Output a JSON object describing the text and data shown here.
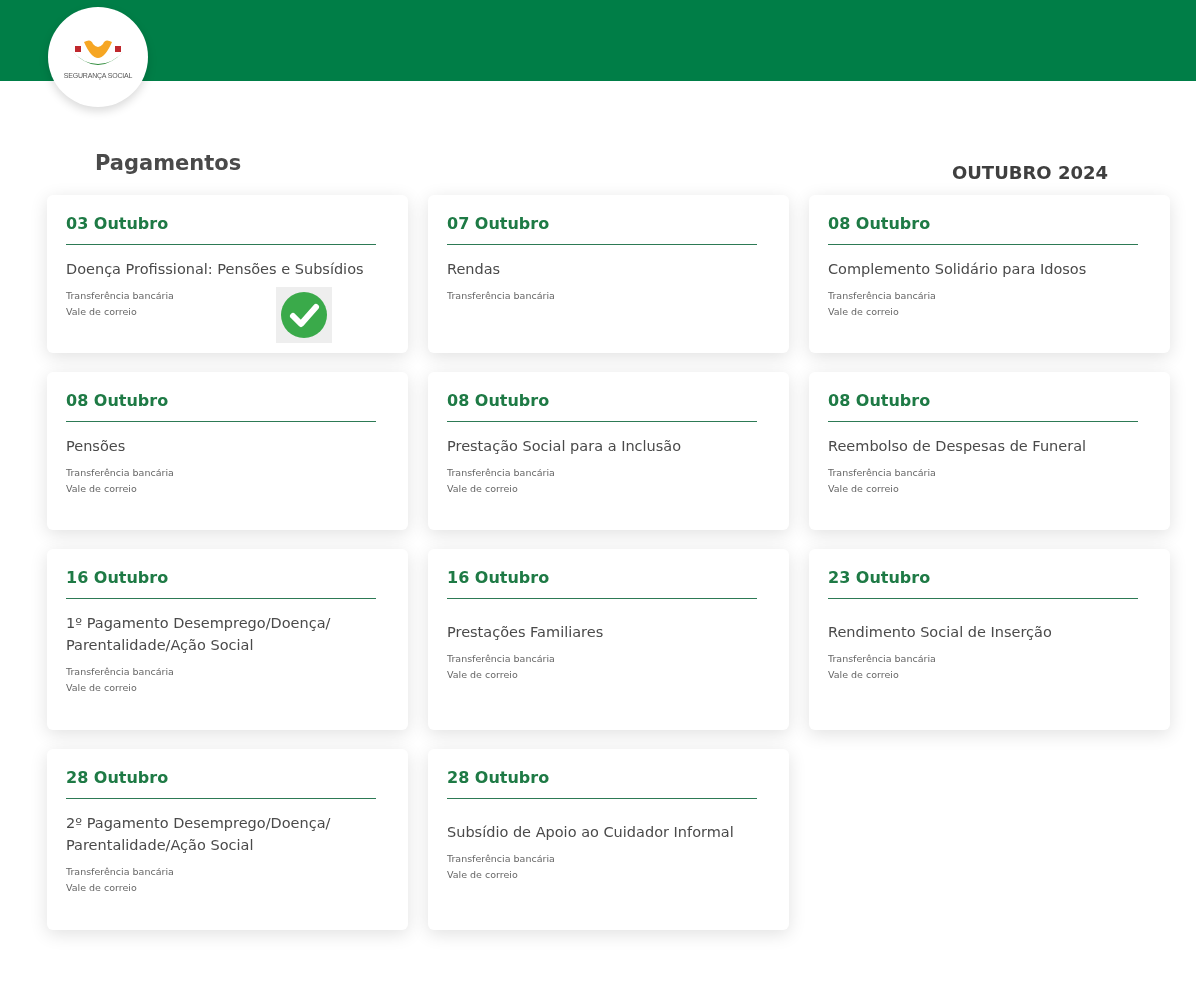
{
  "logo": {
    "text": "SEGURANÇA SOCIAL"
  },
  "heading": "Pagamentos",
  "month": "OUTUBRO 2024",
  "payments": [
    {
      "date": "03 Outubro",
      "title": "Doença Profissional: Pensões e Subsídios",
      "methods": [
        "Transferência bancária",
        "Vale de correio"
      ],
      "paid": true
    },
    {
      "date": "07 Outubro",
      "title": "Rendas",
      "methods": [
        "Transferência bancária"
      ],
      "paid": false
    },
    {
      "date": "08 Outubro",
      "title": "Complemento Solidário para Idosos",
      "methods": [
        "Transferência bancária",
        "Vale de correio"
      ],
      "paid": false
    },
    {
      "date": "08 Outubro",
      "title": "Pensões",
      "methods": [
        "Transferência bancária",
        "Vale de correio"
      ],
      "paid": false
    },
    {
      "date": "08 Outubro",
      "title": "Prestação Social para a Inclusão",
      "methods": [
        "Transferência bancária",
        "Vale de correio"
      ],
      "paid": false
    },
    {
      "date": "08 Outubro",
      "title": "Reembolso de Despesas de Funeral",
      "methods": [
        "Transferência bancária",
        "Vale de correio"
      ],
      "paid": false
    },
    {
      "date": "16 Outubro",
      "title": "1º Pagamento Desemprego/Doença/ Parentalidade/Ação Social",
      "methods": [
        "Transferência bancária",
        "Vale de correio"
      ],
      "paid": false
    },
    {
      "date": "16 Outubro",
      "title": "Prestações Familiares",
      "methods": [
        "Transferência bancária",
        "Vale de correio"
      ],
      "paid": false
    },
    {
      "date": "23 Outubro",
      "title": "Rendimento Social de Inserção",
      "methods": [
        "Transferência bancária",
        "Vale de correio"
      ],
      "paid": false
    },
    {
      "date": "28 Outubro",
      "title": "2º Pagamento Desemprego/Doença/ Parentalidade/Ação Social",
      "methods": [
        "Transferência bancária",
        "Vale de correio"
      ],
      "paid": false
    },
    {
      "date": "28 Outubro",
      "title": "Subsídio de Apoio ao Cuidador Informal",
      "methods": [
        "Transferência bancária",
        "Vale de correio"
      ],
      "paid": false
    }
  ]
}
